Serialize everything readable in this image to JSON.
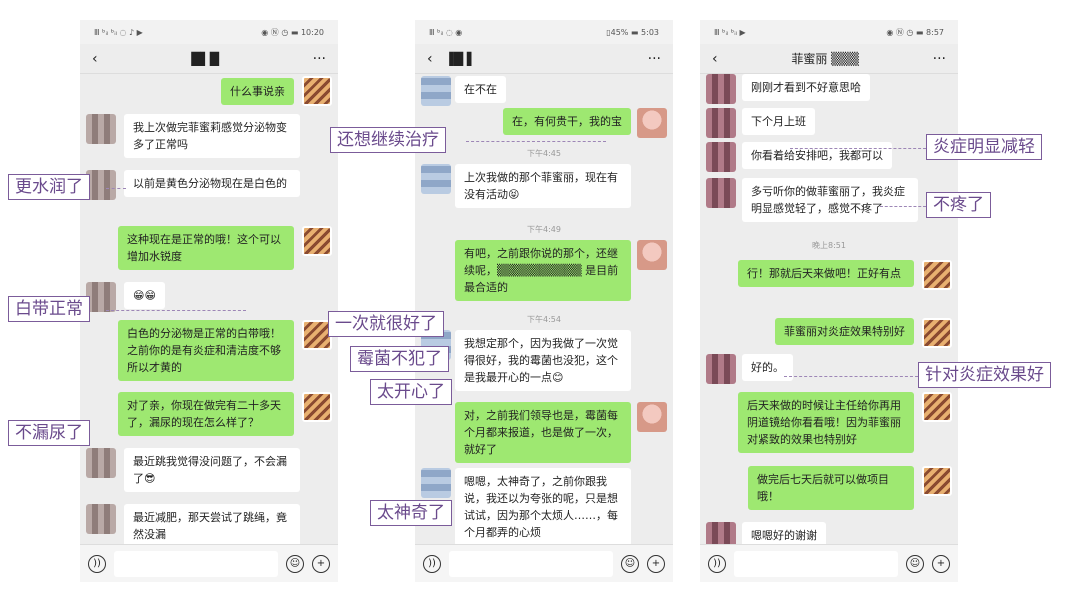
{
  "phones": [
    {
      "status": {
        "left": "Ⅲ ᵇᵢₗ ᵇᵢₗ ◌ ♪ ▶",
        "right": "◉ Ⓝ ◷ ▬ 10:20"
      },
      "title": "█▌█",
      "more": "···",
      "msgs": {
        "m1": "什么事说亲",
        "m2": "我上次做完菲蜜莉感觉分泌物变多了正常吗",
        "m3": "以前是黄色分泌物现在是白色的",
        "m4": "这种现在是正常的哦！这个可以增加水锐度",
        "m5": "😁😁",
        "m6": "白色的分泌物是正常的白带哦！之前你的是有炎症和清洁度不够所以才黄的",
        "m7": "对了亲，你现在做完有二十多天了，漏尿的现在怎么样了？",
        "m8": "最近跳我觉得没问题了，不会漏了😎",
        "m9": "最近减肥，那天尝试了跳绳，竟然没漏"
      }
    },
    {
      "status": {
        "left": "Ⅲ ᵇᵢₗ ◌ ◉",
        "right": "▯45% ▬ 5:03"
      },
      "title": "▐█ ▌",
      "more": "···",
      "msgs": {
        "m1": "在不在",
        "m2": "在，有何贵干，我的宝",
        "t1": "下午4:45",
        "m3": "上次我做的那个菲蜜丽，现在有没有活动😝",
        "t2": "下午4:49",
        "m4": "有吧，之前跟你说的那个，还继续呢，▒▒▒▒▒▒▒▒▒▒ 是目前最合适的",
        "t3": "下午4:54",
        "m5": "我想定那个，因为我做了一次觉得很好，我的霉菌也没犯，这个是我最开心的一点😊",
        "m6": "对，之前我们领导也是，霉菌每个月都来报道，也是做了一次，就好了",
        "m7": "嗯嗯，太神奇了，之前你跟我说，我还以为夸张的呢，只是想试试，因为那个太烦人……，每个月都弄的心烦"
      }
    },
    {
      "status": {
        "left": "Ⅲ ᵇᵢₗ ᵇᵢₗ ▶",
        "right": "◉ Ⓝ ◷ ▬ 8:57"
      },
      "title": "菲蜜丽 ▒▒▒",
      "more": "···",
      "msgs": {
        "m1": "刚刚才看到不好意思哈",
        "m2": "下个月上班",
        "m3": "你看着给安排吧，我都可以",
        "m4": "多亏听你的做菲蜜丽了，我炎症明显感觉轻了，感觉不疼了",
        "t1": "晚上8:51",
        "m5": "行！那就后天来做吧！正好有点",
        "m6": "菲蜜丽对炎症效果特别好",
        "m7": "好的。",
        "m8": "后天来做的时候让主任给你再用阴道镜给你看看哦！因为菲蜜丽对紧致的效果也特别好",
        "m9": "做完后七天后就可以做项目哦！",
        "m10": "嗯嗯好的谢谢"
      }
    }
  ],
  "labels": {
    "a": "更水润了",
    "b": "白带正常",
    "c": "不漏尿了",
    "d": "还想继续治疗",
    "e": "一次就很好了",
    "f": "霉菌不犯了",
    "g": "太开心了",
    "h": "太神奇了",
    "i": "炎症明显减轻",
    "j": "不疼了",
    "k": "针对炎症效果好"
  },
  "icons": {
    "voice": "voice-icon",
    "emoji": "emoji-icon",
    "plus": "plus-icon",
    "back": "back-icon"
  }
}
